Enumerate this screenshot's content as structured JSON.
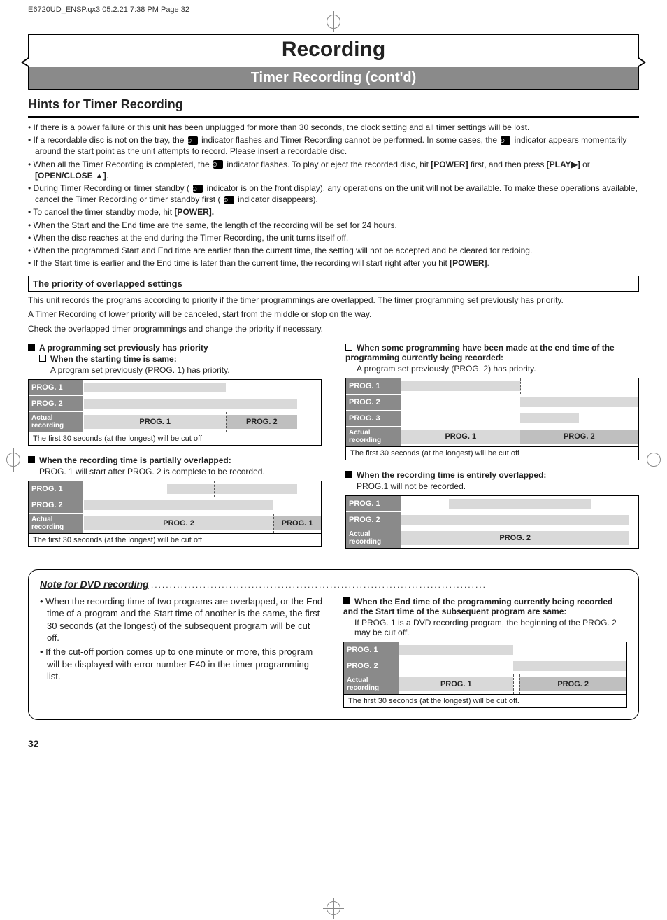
{
  "running_head": "E6720UD_ENSP.qx3   05.2.21 7:38 PM   Page 32",
  "title": "Recording",
  "subtitle": "Timer Recording (cont'd)",
  "section_heading": "Hints for Timer Recording",
  "hints": [
    "If there is a power failure or this unit has been unplugged for more than 30 seconds, the clock setting and all timer settings will be lost.",
    "If a recordable disc is not on the tray, the ⏲ indicator flashes and Timer Recording cannot be performed. In some cases, the ⏲ indicator appears momentarily around the start point as the unit attempts to record. Please insert a recordable disc.",
    "When all the Timer Recording is completed, the ⏲ indicator flashes. To play or eject the recorded disc, hit [POWER] first, and then press [PLAY▶] or [OPEN/CLOSE ▲].",
    "During Timer Recording or timer standby ( ⏲ indicator is on the front display), any operations on the unit will not be available. To make these operations available, cancel the Timer Recording or timer standby first ( ⏲ indicator disappears).",
    "To cancel the timer standby mode, hit [POWER].",
    "When the Start and the End time are the same, the length of the recording will be set for 24 hours.",
    "When the disc reaches at the end during the Timer Recording, the unit turns itself off.",
    "When the programmed Start and End time are earlier than the current time, the setting will not be accepted and be cleared for redoing.",
    "If the Start time is earlier and the End time is later than the current time, the recording will start right after you hit [POWER]."
  ],
  "priority_box_title": "The priority of overlapped settings",
  "priority_para1": "This unit records the programs according to priority if the timer programmings are overlapped. The timer programming set previously has priority.",
  "priority_para2": " A Timer Recording of lower priority will be canceled, start from the middle or stop on the way.",
  "priority_para3": "Check the overlapped timer programmings and change the priority if necessary.",
  "caseA_head": "A programming set previously has priority",
  "caseA_sub_head": "When the starting time is same:",
  "caseA_sub_text": "A program set previously (PROG. 1) has priority.",
  "caseB_head": "When some programming have been made at the end time of the programming currently being recorded:",
  "caseB_text": "A program set previously (PROG. 2) has priority.",
  "caseC_head": "When the recording time is partially overlapped:",
  "caseC_text": "PROG. 1 will start after PROG. 2 is complete to be recorded.",
  "caseD_head": "When the recording time is entirely overlapped:",
  "caseD_text": "PROG.1 will not be recorded.",
  "labels": {
    "prog1": "PROG. 1",
    "prog2": "PROG. 2",
    "prog3": "PROG. 3",
    "actual": "Actual recording"
  },
  "cutoff_note": "The first 30 seconds (at the longest) will be cut off",
  "cutoff_note_period": "The first 30 seconds (at the longest) will be cut off.",
  "note_heading": "Note for DVD recording",
  "note_left": [
    "When the recording time of two programs are overlapped, or the End time of a program and the Start time of another is the same, the first 30 seconds (at the longest) of the subsequent program will be cut off.",
    "If the cut-off portion comes up to one minute or more, this program will be displayed with error number E40 in the timer programming list."
  ],
  "note_right_head": "When the End time of the programming currently being recorded and the Start time of the subsequent program are same:",
  "note_right_text": "If PROG. 1 is a DVD recording program, the beginning of the PROG. 2 may be cut off.",
  "page_number": "32"
}
